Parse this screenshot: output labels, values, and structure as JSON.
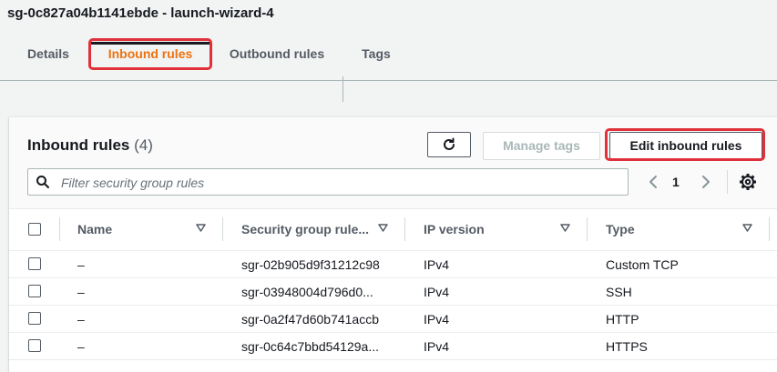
{
  "page": {
    "title": "sg-0c827a04b1141ebde - launch-wizard-4"
  },
  "tabs": [
    {
      "label": "Details"
    },
    {
      "label": "Inbound rules"
    },
    {
      "label": "Outbound rules"
    },
    {
      "label": "Tags"
    }
  ],
  "panel": {
    "title": "Inbound rules",
    "count": "(4)",
    "refresh_icon": "refresh-icon",
    "manage_tags_label": "Manage tags",
    "edit_label": "Edit inbound rules",
    "search_placeholder": "Filter security group rules",
    "page_number": "1"
  },
  "table": {
    "columns": [
      "Name",
      "Security group rule...",
      "IP version",
      "Type"
    ],
    "rows": [
      {
        "name": "–",
        "rule_id": "sgr-02b905d9f31212c98",
        "ip_version": "IPv4",
        "type": "Custom TCP"
      },
      {
        "name": "–",
        "rule_id": "sgr-03948004d796d0...",
        "ip_version": "IPv4",
        "type": "SSH"
      },
      {
        "name": "–",
        "rule_id": "sgr-0a2f47d60b741accb",
        "ip_version": "IPv4",
        "type": "HTTP"
      },
      {
        "name": "–",
        "rule_id": "sgr-0c64c7bbd54129a...",
        "ip_version": "IPv4",
        "type": "HTTPS"
      }
    ]
  },
  "colors": {
    "active_tab": "#ec7211",
    "highlight": "#e0303a",
    "text": "#16191f",
    "muted": "#545b64"
  }
}
